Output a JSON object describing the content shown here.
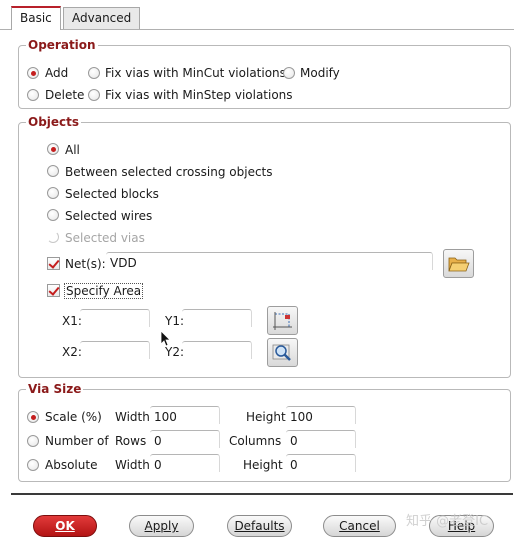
{
  "tabs": [
    {
      "label": "Basic",
      "active": true
    },
    {
      "label": "Advanced",
      "active": false
    }
  ],
  "operation": {
    "title": "Operation",
    "options": [
      {
        "label": "Add",
        "checked": true
      },
      {
        "label": "Fix vias with MinCut violations",
        "checked": false
      },
      {
        "label": "Modify",
        "checked": false
      },
      {
        "label": "Delete",
        "checked": false
      },
      {
        "label": "Fix vias with MinStep violations",
        "checked": false
      }
    ]
  },
  "objects": {
    "title": "Objects",
    "options": [
      {
        "label": "All",
        "checked": true,
        "enabled": true
      },
      {
        "label": "Between selected crossing objects",
        "checked": false,
        "enabled": true
      },
      {
        "label": "Selected blocks",
        "checked": false,
        "enabled": true
      },
      {
        "label": "Selected wires",
        "checked": false,
        "enabled": true
      },
      {
        "label": "Selected vias",
        "checked": false,
        "enabled": false
      }
    ],
    "nets": {
      "label": "Net(s):",
      "checked": true,
      "value": "VDD"
    },
    "specify_area": {
      "label": "Specify Area",
      "checked": true
    },
    "area": {
      "x1_label": "X1:",
      "y1_label": "Y1:",
      "x2_label": "X2:",
      "y2_label": "Y2:",
      "x1": "",
      "y1": "",
      "x2": "",
      "y2": ""
    }
  },
  "via_size": {
    "title": "Via Size",
    "rows": [
      {
        "label": "Scale (%)",
        "checked": true,
        "field1_label": "Width",
        "field1": "100",
        "field2_label": "Height",
        "field2": "100"
      },
      {
        "label": "Number of",
        "checked": false,
        "field1_label": "Rows",
        "field1": "0",
        "field2_label": "Columns",
        "field2": "0"
      },
      {
        "label": "Absolute",
        "checked": false,
        "field1_label": "Width",
        "field1": "0",
        "field2_label": "Height",
        "field2": "0"
      }
    ]
  },
  "buttons": {
    "ok": "OK",
    "apply": "Apply",
    "defaults": "Defaults",
    "cancel": "Cancel",
    "help": "Help"
  },
  "watermark": "知乎 @老登IC",
  "colors": {
    "accent": "#c41e1e",
    "group_title": "#8b1a1a"
  }
}
